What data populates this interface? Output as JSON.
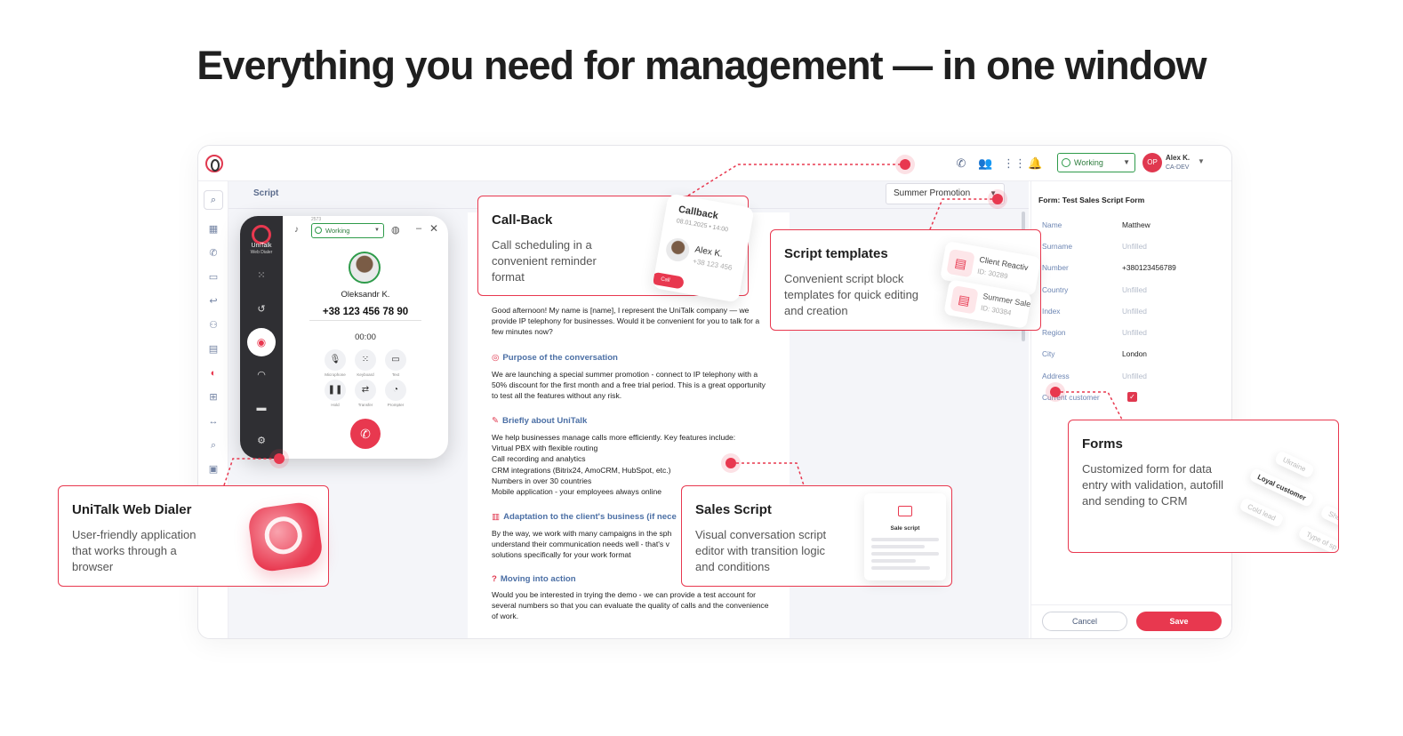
{
  "headline": "Everything you need for management — in one window",
  "app": {
    "topbar": {
      "status": "Working",
      "avatar_initials": "OP",
      "user_name": "Alex K.",
      "user_sub": "CA-DEV"
    },
    "script_label": "Script",
    "template_select": "Summer Promotion"
  },
  "script": {
    "intro": "Good afternoon! My name is [name], I represent the UniTalk company — we provide IP telephony for businesses. Would it be convenient for you to talk for a few minutes now?",
    "h1": "Purpose of the conversation",
    "p1": "We are launching a special summer promotion - connect to IP telephony with a 50% discount for the first month and a free trial period. This is a great opportunity to test all the features without any risk.",
    "h2": "Briefly about UniTalk",
    "p2_lines": [
      "We help businesses manage calls more efficiently. Key features include:",
      "Virtual PBX with flexible routing",
      "Call recording and analytics",
      "CRM integrations (Bitrix24, AmoCRM, HubSpot, etc.)",
      "Numbers in over 30 countries",
      "Mobile application - your employees always online"
    ],
    "h3": "Adaptation to the client's business  (if nece",
    "p3": "By the way, we work with many campaigns in the sph understand their communication needs well - that's v solutions specifically for your work format",
    "h4": "Moving into action",
    "p4": "Would you be interested in trying the demo - we can provide a test account for several numbers so that you can evaluate the quality of calls and the convenience of work."
  },
  "form": {
    "title": "Form: Test Sales Script Form",
    "fields": [
      {
        "label": "Name",
        "value": "Matthew"
      },
      {
        "label": "Surname",
        "value": "Unfilled"
      },
      {
        "label": "Number",
        "value": "+380123456789"
      },
      {
        "label": "Country",
        "value": "Unfilled"
      },
      {
        "label": "Index",
        "value": "Unfilled"
      },
      {
        "label": "Region",
        "value": "Unfilled"
      },
      {
        "label": "City",
        "value": "London"
      },
      {
        "label": "Address",
        "value": "Unfilled"
      }
    ],
    "checkbox_label": "Current customer",
    "cancel": "Cancel",
    "save": "Save"
  },
  "dialer": {
    "brand": "UniTalk",
    "brand_sub": "Web Dialer",
    "extension": "2573",
    "status": "Working",
    "contact_name": "Oleksandr K.",
    "contact_number": "+38 123 456 78 90",
    "timer": "00:00",
    "controls": [
      "Microphone",
      "Keyboard",
      "Text",
      "Hold",
      "Transfer",
      "Prompter"
    ]
  },
  "callouts": {
    "callback": {
      "title": "Call-Back",
      "desc": "Call scheduling in a convenient reminder format",
      "ticket_title": "Callback",
      "ticket_date": "08.01.2025 • 14:00",
      "ticket_name": "Alex K.",
      "ticket_number": "+38 123 456",
      "ticket_button": "Call"
    },
    "templates": {
      "title": "Script templates",
      "desc": "Convenient script block templates for quick editing and creation",
      "card1_name": "Client Reactiv",
      "card1_id": "ID: 30289",
      "card2_name": "Summer Sale",
      "card2_id": "ID: 30384"
    },
    "dialer": {
      "title": "UniTalk Web Dialer",
      "desc": "User-friendly application that works through a browser"
    },
    "sales": {
      "title": "Sales Script",
      "desc": "Visual conversation script editor with transition logic and conditions",
      "card_label": "Sale script"
    },
    "forms": {
      "title": "Forms",
      "desc": "Customized form for data entry with validation, autofill and sending to CRM",
      "chips": [
        "Ukraine",
        "Loyal customer",
        "Cold lead",
        "Type of sp",
        "Sho"
      ]
    }
  },
  "colors": {
    "accent": "#e8384f",
    "status_green": "#2e9b4a",
    "heading_blue": "#4b6fa5"
  }
}
